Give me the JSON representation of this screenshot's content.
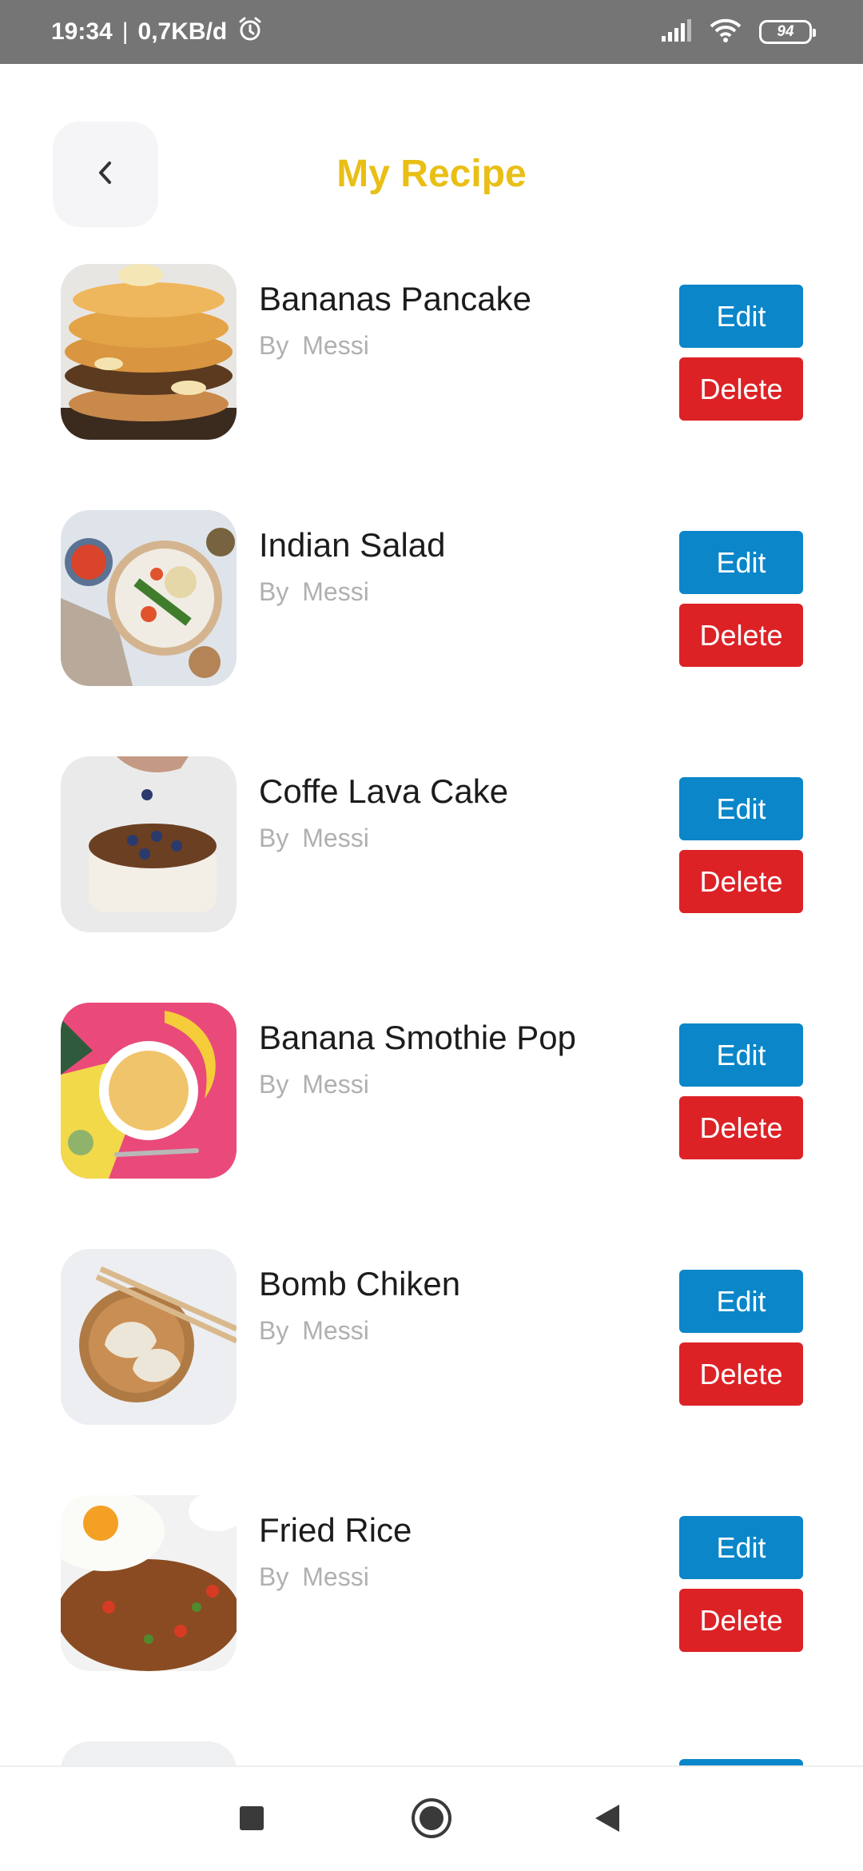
{
  "status_bar": {
    "time": "19:34",
    "separator": "|",
    "network_speed": "0,7KB/d",
    "battery_level": "94",
    "icons": [
      "alarm-icon",
      "signal-icon",
      "wifi-icon",
      "battery-icon"
    ]
  },
  "header": {
    "back_icon": "chevron-left-icon",
    "title": "My Recipe",
    "title_color": "#e9bf16"
  },
  "recipes": [
    {
      "title": "Bananas Pancake",
      "by_label": "By",
      "author": "Messi",
      "image": "pancake-image",
      "edit_label": "Edit",
      "delete_label": "Delete"
    },
    {
      "title": "Indian Salad",
      "by_label": "By",
      "author": "Messi",
      "image": "salad-image",
      "edit_label": "Edit",
      "delete_label": "Delete"
    },
    {
      "title": "Coffe Lava Cake",
      "by_label": "By",
      "author": "Messi",
      "image": "cake-image",
      "edit_label": "Edit",
      "delete_label": "Delete"
    },
    {
      "title": "Banana Smothie Pop",
      "by_label": "By",
      "author": "Messi",
      "image": "smoothie-image",
      "edit_label": "Edit",
      "delete_label": "Delete"
    },
    {
      "title": "Bomb Chiken",
      "by_label": "By",
      "author": "Messi",
      "image": "dumpling-image",
      "edit_label": "Edit",
      "delete_label": "Delete"
    },
    {
      "title": "Fried Rice",
      "by_label": "By",
      "author": "Messi",
      "image": "fried-rice-image",
      "edit_label": "Edit",
      "delete_label": "Delete"
    }
  ],
  "colors": {
    "edit_button": "#0b86c9",
    "delete_button": "#dd2226",
    "status_bar": "#757575"
  },
  "nav_bar": {
    "icons": [
      "recents-square-icon",
      "home-circle-icon",
      "back-triangle-icon"
    ]
  }
}
